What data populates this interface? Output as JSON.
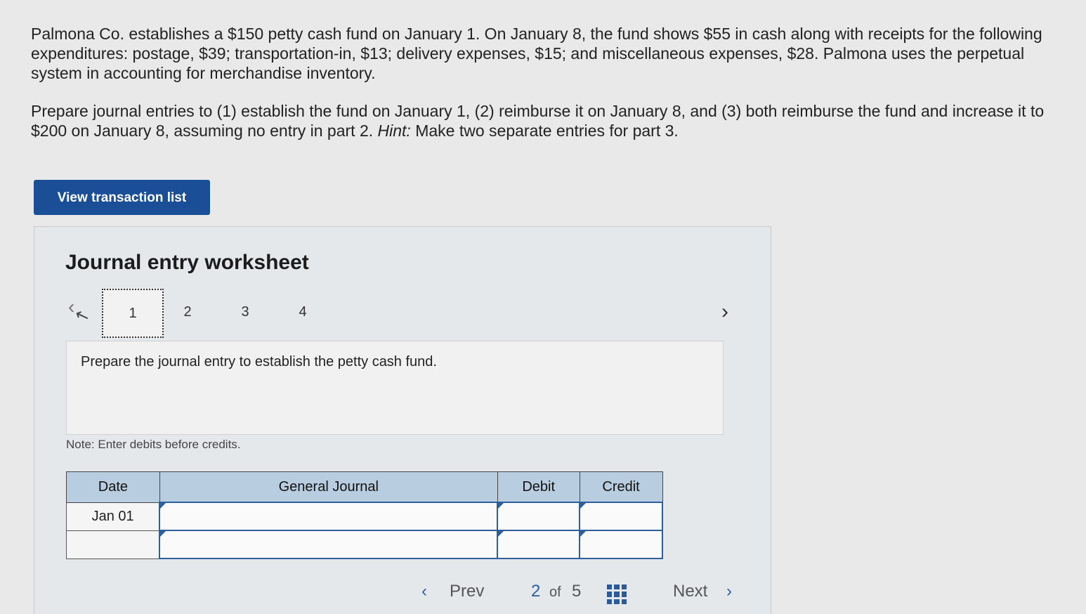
{
  "problem": {
    "paragraph1": "Palmona Co. establishes a $150 petty cash fund on January 1. On January 8, the fund shows $55 in cash along with receipts for the following expenditures: postage, $39; transportation-in, $13; delivery expenses, $15; and miscellaneous expenses, $28. Palmona uses the perpetual system in accounting for merchandise inventory.",
    "paragraph2_main": "Prepare journal entries to (1) establish the fund on January 1, (2) reimburse it on January 8, and (3) both reimburse the fund and increase it to $200 on January 8, assuming no entry in part 2. ",
    "paragraph2_hint_label": "Hint:",
    "paragraph2_hint_text": " Make two separate entries for part 3."
  },
  "view_transaction_button": "View transaction list",
  "worksheet": {
    "title": "Journal entry worksheet",
    "steps": [
      "1",
      "2",
      "3",
      "4"
    ],
    "active_step": "1",
    "instruction": "Prepare the journal entry to establish the petty cash fund.",
    "note": "Note: Enter debits before credits.",
    "table": {
      "headers": {
        "date": "Date",
        "general_journal": "General Journal",
        "debit": "Debit",
        "credit": "Credit"
      },
      "rows": [
        {
          "date": "Jan 01",
          "account": "",
          "debit": "",
          "credit": ""
        },
        {
          "date": "",
          "account": "",
          "debit": "",
          "credit": ""
        }
      ]
    }
  },
  "pagination": {
    "prev_label": "Prev",
    "current": "2",
    "of_label": "of",
    "total": "5",
    "next_label": "Next"
  },
  "icons": {
    "nav_left": "chevron-left-icon",
    "nav_right": "chevron-right-icon",
    "grid": "grid-icon"
  },
  "colors": {
    "button_bg": "#1a4f98",
    "table_header_bg": "#b9cde0",
    "accent": "#2d5ea0"
  }
}
